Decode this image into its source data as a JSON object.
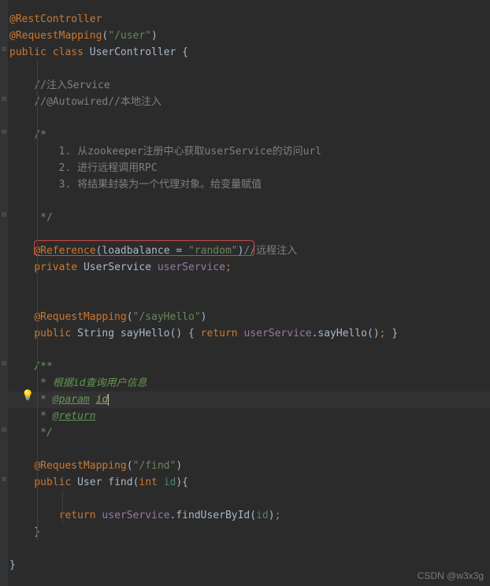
{
  "annotations": {
    "restController": "@RestController",
    "requestMapping": "@RequestMapping",
    "reference": "@Reference",
    "refArg": "loadbalance",
    "refVal": "\"random\"",
    "userPath": "\"/user\"",
    "sayHelloPath": "\"/sayHello\"",
    "findPath": "\"/find\""
  },
  "keywords": {
    "public": "public",
    "class": "class",
    "private": "private",
    "return": "return",
    "int": "int"
  },
  "identifiers": {
    "className": "UserController",
    "stringType": "String",
    "userType": "User",
    "userServiceType": "UserService",
    "userServiceField": "userService",
    "sayHelloMethod": "sayHello",
    "findMethod": "find",
    "findUserById": "findUserById",
    "idParam": "id"
  },
  "comments": {
    "injectService": "//注入Service",
    "autowired": "//@Autowired//本地注入",
    "docStart": "/*",
    "docLine1": "    1. 从zookeeper注册中心获取userService的访问url",
    "docLine2": "    2. 进行远程调用RPC",
    "docLine3": "    3. 将结果封装为一个代理对象。给变量赋值",
    "docEnd": " */",
    "remoteInject": "//远程注入",
    "javadocStart": "/**",
    "javadocDesc": " * 根据id查询用户信息",
    "javadocParamTag": "@param",
    "javadocParamName": "id",
    "javadocReturnTag": "@return",
    "javadocLinePrefix": " * ",
    "javadocEnd": " */"
  },
  "watermark": "CSDN @w3x3g"
}
